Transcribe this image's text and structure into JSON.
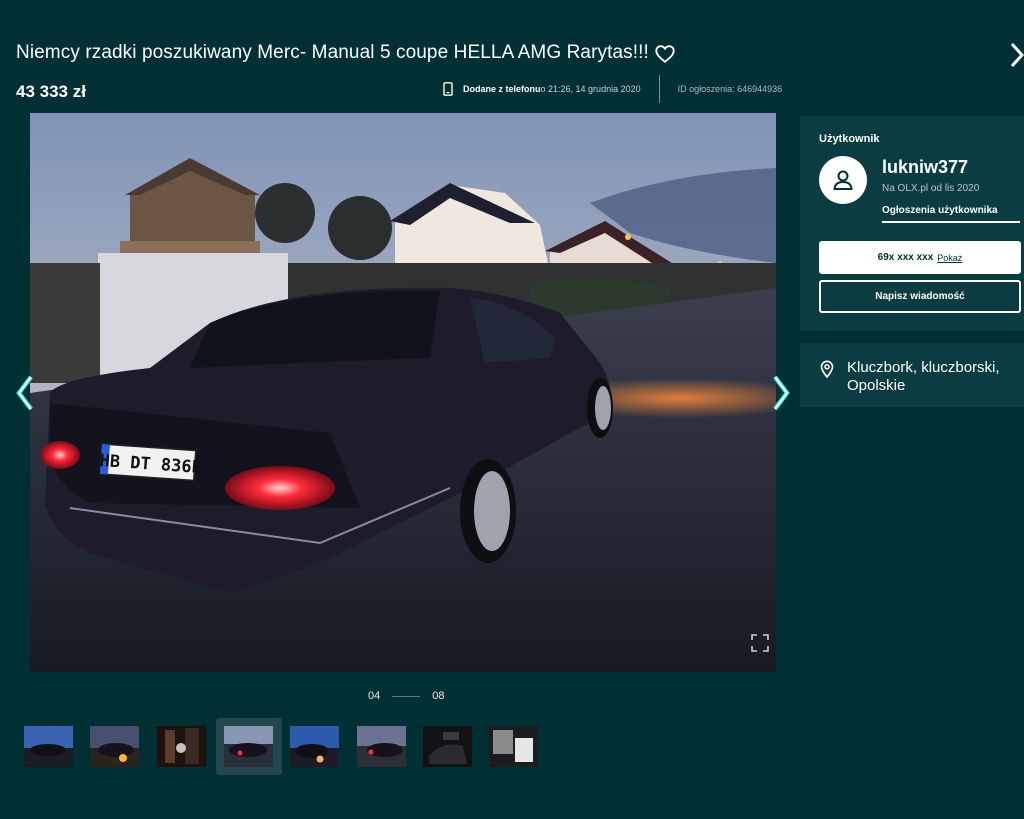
{
  "listing": {
    "title": "Niemcy rzadki poszukiwany Merc- Manual 5 coupe HELLA AMG Rarytas!!!",
    "price": "43 333 zł",
    "added_label": "Dodane z telefonu",
    "added_time": " o 21:26, 14 grudnia 2020",
    "ad_id": "ID ogłoszenia: 646944936"
  },
  "gallery": {
    "current": "04",
    "total": "08",
    "plate": "HB DT 836E"
  },
  "user": {
    "section_label": "Użytkownik",
    "name": "lukniw377",
    "since": "Na OLX.pl od lis 2020",
    "ads_link": "Ogłoszenia użytkownika",
    "phone": "69x xxx xxx",
    "show_phone": "Pokaż",
    "message_button": "Napisz wiadomość"
  },
  "location": {
    "text": "Kluczbork, kluczborski, Opolskie"
  },
  "icons": {
    "favorite": "heart-icon",
    "close": "chevron-right-icon",
    "phone": "smartphone-icon",
    "prev": "chevron-left-icon",
    "next": "chevron-right-icon",
    "expand": "fullscreen-icon",
    "avatar": "user-icon",
    "location": "map-pin-icon"
  },
  "colors": {
    "background": "#002f34",
    "card": "#0b3c41",
    "accent": "#ffffff"
  }
}
